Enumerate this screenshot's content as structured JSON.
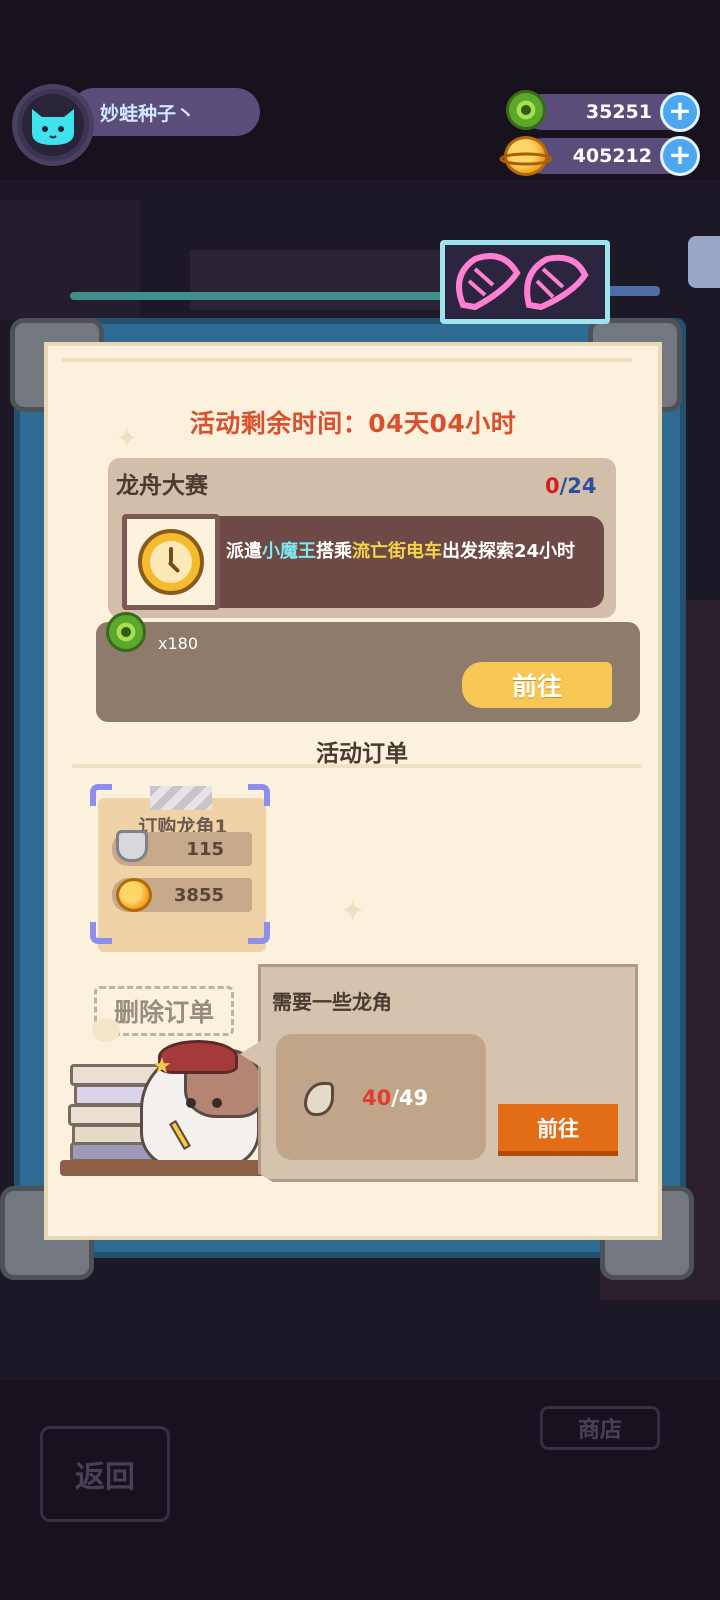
{
  "player": {
    "name": "妙蛙种子丶"
  },
  "currencies": [
    {
      "icon": "green-donut-coin-icon",
      "amount": "35251",
      "add_label": "+"
    },
    {
      "icon": "gold-planet-coin-icon",
      "amount": "405212",
      "add_label": "+"
    }
  ],
  "event": {
    "time_left": "活动剩余时间：04天04小时",
    "race": {
      "title": "龙舟大赛",
      "progress_current": "0",
      "progress_total": "/24",
      "task_prefix": "派遣",
      "task_who": "小魔王",
      "task_mid": "搭乘",
      "task_vehicle": "流亡街电车",
      "task_suffix": "出发探索24小时",
      "reward_qty": "x180",
      "go_label": "前往"
    },
    "orders_title": "活动订单",
    "order": {
      "title": "订购龙角1",
      "cost_bolts": "115",
      "cost_coins": "3855"
    },
    "delete_label": "删除订单",
    "need": {
      "title": "需要一些龙角",
      "have": "40",
      "total": "/49",
      "go_label": "前往"
    }
  },
  "background": {
    "back_label": "返回",
    "shop_label": "商店"
  },
  "colors": {
    "timer": "#d8502d",
    "accent_orange": "#e36c16",
    "accent_yellow": "#f6c754",
    "name_text": "#cfe7ff",
    "highlight_cyan": "#7fe9f0",
    "highlight_yellow": "#f5d34c"
  }
}
